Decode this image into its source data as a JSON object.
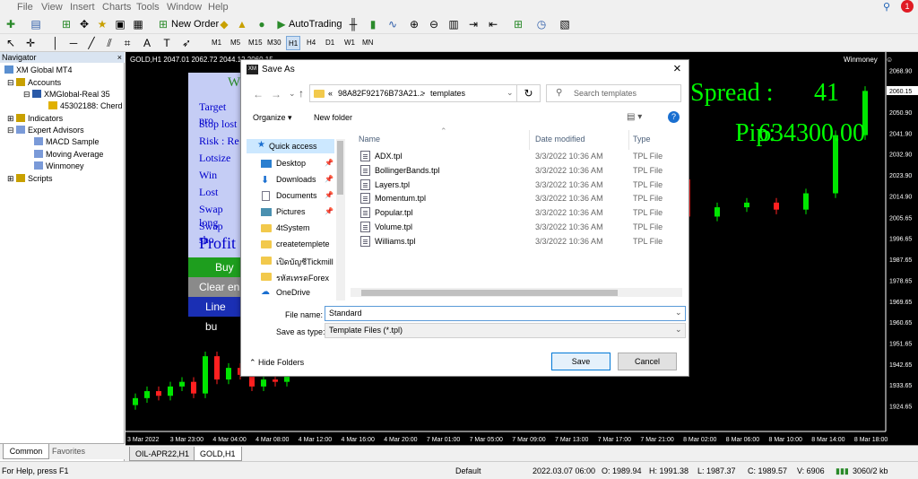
{
  "menu": [
    "File",
    "View",
    "Insert",
    "Charts",
    "Tools",
    "Window",
    "Help"
  ],
  "toolbar": {
    "new_order": "New Order",
    "autotrading": "AutoTrading"
  },
  "timeframes": [
    "M1",
    "M5",
    "M15",
    "M30",
    "H1",
    "H4",
    "D1",
    "W1",
    "MN"
  ],
  "navigator": {
    "title": "Navigator",
    "items": [
      "XM Global MT4",
      "Accounts",
      "XMGlobal-Real 35",
      "45302188: Cherd",
      "Indicators",
      "Expert Advisors",
      "MACD Sample",
      "Moving Average",
      "Winmoney",
      "Scripts"
    ],
    "tabs": [
      "Common",
      "Favorites"
    ]
  },
  "chart": {
    "header": "GOLD,H1  2047.01 2062.72 2044.12 2060.15",
    "ea_name": "Winmoney",
    "spread_label": "Spread :",
    "spread_value": "41",
    "pips_label": "Pip:",
    "pips_value": "634300.00",
    "panel": [
      "Target pro",
      "Stop lost",
      "Risk : Re",
      "Lotsize",
      "Win",
      "Lost",
      "Swap long",
      "Swap sho",
      "Profit"
    ],
    "panel_title": "W",
    "buttons": {
      "buy": "Buy",
      "clear": "Clear en",
      "line": "Line bu"
    },
    "price_tag": "2060.15",
    "y_ticks": [
      "2068.90",
      "2050.90",
      "2041.90",
      "2032.90",
      "2023.90",
      "2014.90",
      "2005.65",
      "1996.65",
      "1987.65",
      "1978.65",
      "1969.65",
      "1960.65",
      "1951.65",
      "1942.65",
      "1933.65",
      "1924.65"
    ],
    "x_ticks": [
      "3 Mar 2022",
      "3 Mar 23:00",
      "4 Mar 04:00",
      "4 Mar 08:00",
      "4 Mar 12:00",
      "4 Mar 16:00",
      "4 Mar 20:00",
      "7 Mar 01:00",
      "7 Mar 05:00",
      "7 Mar 09:00",
      "7 Mar 13:00",
      "7 Mar 17:00",
      "7 Mar 21:00",
      "8 Mar 02:00",
      "8 Mar 06:00",
      "8 Mar 10:00",
      "8 Mar 14:00",
      "8 Mar 18:00"
    ],
    "tabs": [
      "OIL-APR22,H1",
      "GOLD,H1"
    ]
  },
  "colors": {
    "bull": "#00e600",
    "bear": "#ff2020",
    "spread": "#00ff00"
  },
  "chart_data": {
    "type": "candlestick",
    "ohlc_close_approx": [
      1928,
      1931,
      1929,
      1933,
      1935,
      1930,
      1946,
      1936,
      1941,
      1938,
      1933,
      1936,
      1935,
      1940,
      1946,
      1941,
      1944,
      1948,
      1946,
      1985,
      1989,
      1984,
      1990,
      1993,
      1988,
      2016,
      2022,
      2006,
      2010,
      2012,
      2009,
      2016,
      2041,
      2060
    ]
  },
  "dialog": {
    "title": "Save As",
    "path_prefix": "«",
    "path": "98A82F92176B73A21...",
    "path_sep": ">",
    "path_current": "templates",
    "search_placeholder": "Search templates",
    "organize": "Organize",
    "new_folder": "New folder",
    "quick_access": "Quick access",
    "sidebar": [
      "Desktop",
      "Downloads",
      "Documents",
      "Pictures",
      "4tSystem",
      "createtemplete",
      "เปิดบัญชีTickmill",
      "รหัสเทรดForex",
      "OneDrive"
    ],
    "columns": [
      "Name",
      "Date modified",
      "Type"
    ],
    "files": [
      {
        "name": "ADX.tpl",
        "date": "3/3/2022 10:36 AM",
        "type": "TPL File"
      },
      {
        "name": "BollingerBands.tpl",
        "date": "3/3/2022 10:36 AM",
        "type": "TPL File"
      },
      {
        "name": "Layers.tpl",
        "date": "3/3/2022 10:36 AM",
        "type": "TPL File"
      },
      {
        "name": "Momentum.tpl",
        "date": "3/3/2022 10:36 AM",
        "type": "TPL File"
      },
      {
        "name": "Popular.tpl",
        "date": "3/3/2022 10:36 AM",
        "type": "TPL File"
      },
      {
        "name": "Volume.tpl",
        "date": "3/3/2022 10:36 AM",
        "type": "TPL File"
      },
      {
        "name": "Williams.tpl",
        "date": "3/3/2022 10:36 AM",
        "type": "TPL File"
      }
    ],
    "file_name_label": "File name:",
    "file_name_value": "Standard",
    "save_type_label": "Save as type:",
    "save_type_value": "Template Files (*.tpl)",
    "hide_folders": "Hide Folders",
    "save": "Save",
    "cancel": "Cancel"
  },
  "status": {
    "help": "For Help, press F1",
    "profile": "Default",
    "datetime": "2022.03.07 06:00",
    "open": "O: 1989.94",
    "high": "H: 1991.38",
    "low": "L: 1987.37",
    "close": "C: 1989.57",
    "volume": "V: 6906",
    "traffic": "3060/2 kb"
  }
}
